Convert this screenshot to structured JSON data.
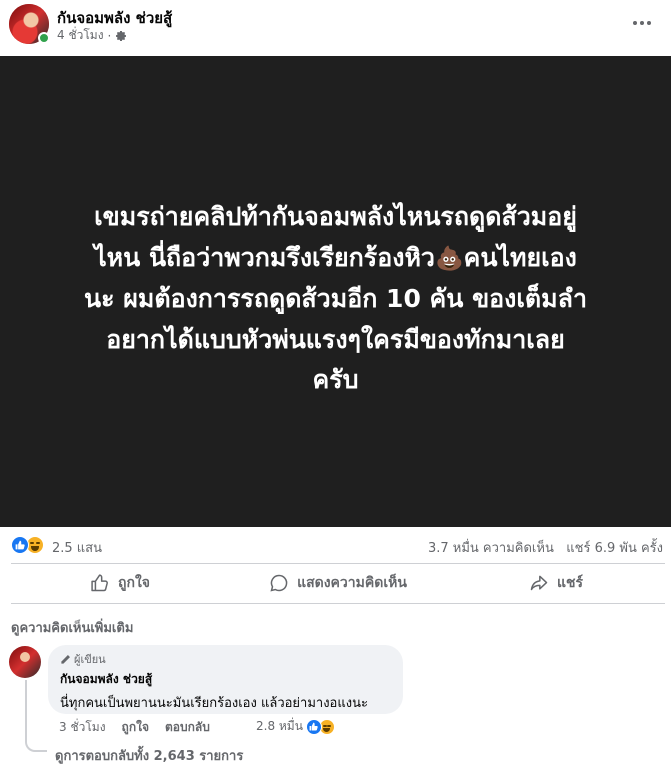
{
  "post": {
    "page_name": "กันจอมพลัง ช่วยสู้",
    "time": "4 ชั่วโมง",
    "separator": "·",
    "privacy_icon": "gear-icon",
    "image_text_line1": "เขมรถ่ายคลิปท้ากันจอมพลังไหนรถดูดส้วมอยู่",
    "image_text_line2a": "ไหน นี่ถือว่าพวกมรึงเรียกร้องหิว",
    "image_text_emoji": "💩",
    "image_text_line2b": "คนไทยเอง",
    "image_text_line3": "นะ ผมต้องการรถดูดส้วมอีก 10 คัน ของเต็มลำ",
    "image_text_line4": "อยากได้แบบหัวพ่นแรงๆใครมีของทักมาเลย",
    "image_text_line5": "ครับ"
  },
  "stats": {
    "reactions": "2.5 แสน",
    "comments": "3.7 หมื่น ความคิดเห็น",
    "shares": "แชร์ 6.9 พัน ครั้ง"
  },
  "actions": {
    "like": "ถูกใจ",
    "comment": "แสดงความคิดเห็น",
    "share": "แชร์"
  },
  "comments_section": {
    "more_comments": "ดูความคิดเห็นเพิ่มเติม",
    "comment": {
      "badge": "ผู้เขียน",
      "author": "กันจอมพลัง ช่วยสู้",
      "text": "นี่ทุกคนเป็นพยานนะมันเรียกร้องเอง แล้วอย่ามางอแงนะ",
      "time": "3 ชั่วโมง",
      "like": "ถูกใจ",
      "reply": "ตอบกลับ",
      "reaction_count": "2.8 หมื่น",
      "replies": "ดูการตอบกลับทั้ง 2,643 รายการ"
    }
  },
  "colors": {
    "image_bg": "#1f1f1f",
    "like_blue": "#1877f2",
    "secondary_text": "#65676b",
    "bubble_bg": "#f0f2f5"
  }
}
